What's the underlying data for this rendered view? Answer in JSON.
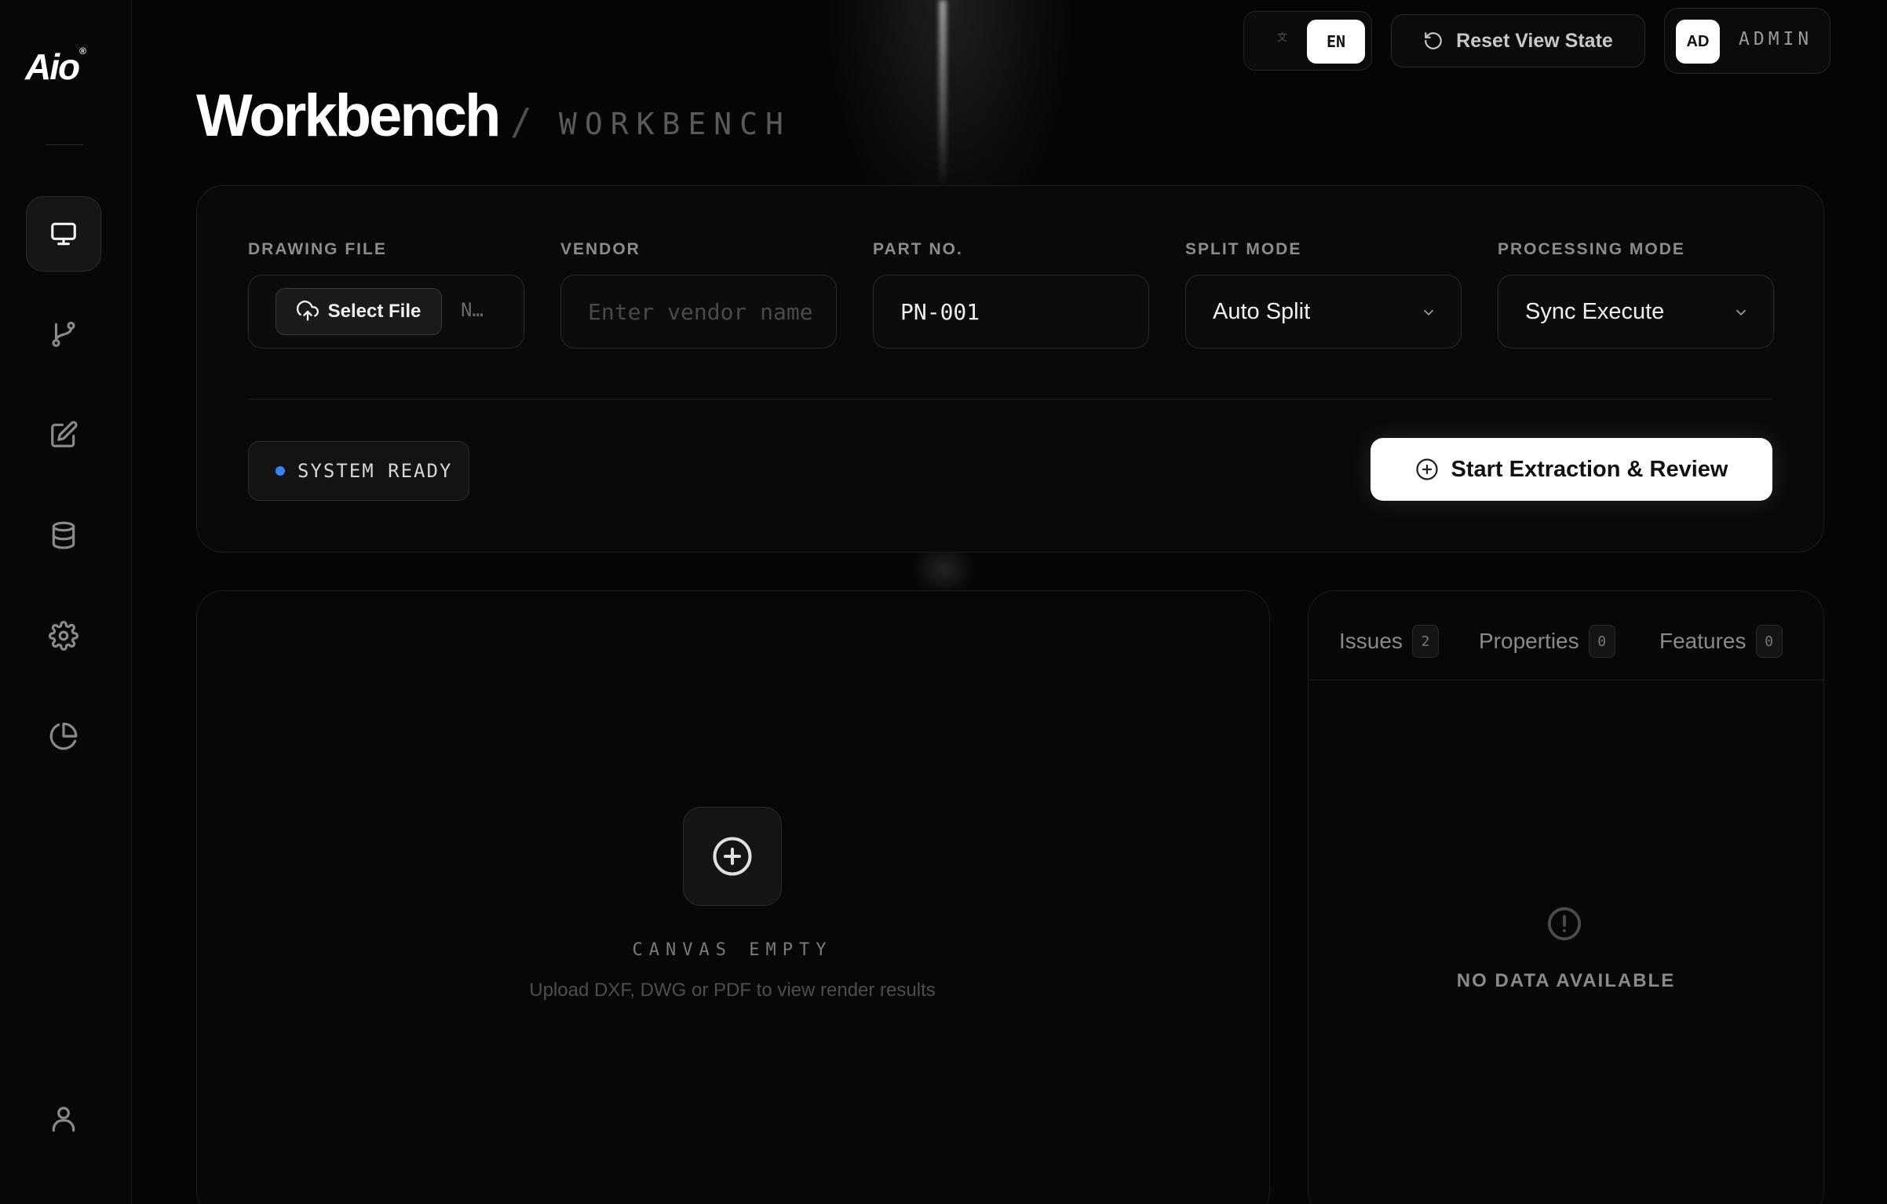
{
  "app": {
    "logo_text": "Aio",
    "logo_mark": "®"
  },
  "sidebar": {
    "items": [
      {
        "name": "workbench",
        "icon": "monitor-icon",
        "active": true
      },
      {
        "name": "workflow",
        "icon": "git-branch-icon",
        "active": false
      },
      {
        "name": "edit",
        "icon": "edit-icon",
        "active": false
      },
      {
        "name": "database",
        "icon": "database-icon",
        "active": false
      },
      {
        "name": "settings",
        "icon": "gear-icon",
        "active": false
      },
      {
        "name": "analytics",
        "icon": "pie-chart-icon",
        "active": false
      }
    ],
    "footer_icon": "user-icon"
  },
  "topbar": {
    "lang_inactive": "文",
    "lang_active": "EN",
    "reset_label": "Reset View State",
    "user_initials": "AD",
    "user_name": "ADMIN"
  },
  "header": {
    "title": "Workbench",
    "separator": "/",
    "breadcrumb": "WORKBENCH"
  },
  "config": {
    "drawing_file": {
      "label": "DRAWING FILE",
      "button": "Select File",
      "file_name": "N…"
    },
    "vendor": {
      "label": "VENDOR",
      "placeholder": "Enter vendor name",
      "value": ""
    },
    "part_no": {
      "label": "PART NO.",
      "value": "PN-001"
    },
    "split_mode": {
      "label": "SPLIT MODE",
      "value": "Auto Split"
    },
    "processing_mode": {
      "label": "PROCESSING MODE",
      "value": "Sync Execute"
    },
    "status": "SYSTEM READY",
    "status_color": "#3b82f6",
    "start_label": "Start Extraction & Review"
  },
  "canvas": {
    "empty_title": "CANVAS EMPTY",
    "empty_hint": "Upload DXF, DWG or PDF to view render results"
  },
  "results": {
    "tabs": [
      {
        "label": "Issues",
        "count": "2"
      },
      {
        "label": "Properties",
        "count": "0"
      },
      {
        "label": "Features",
        "count": "0"
      }
    ],
    "empty_text": "NO DATA AVAILABLE"
  }
}
